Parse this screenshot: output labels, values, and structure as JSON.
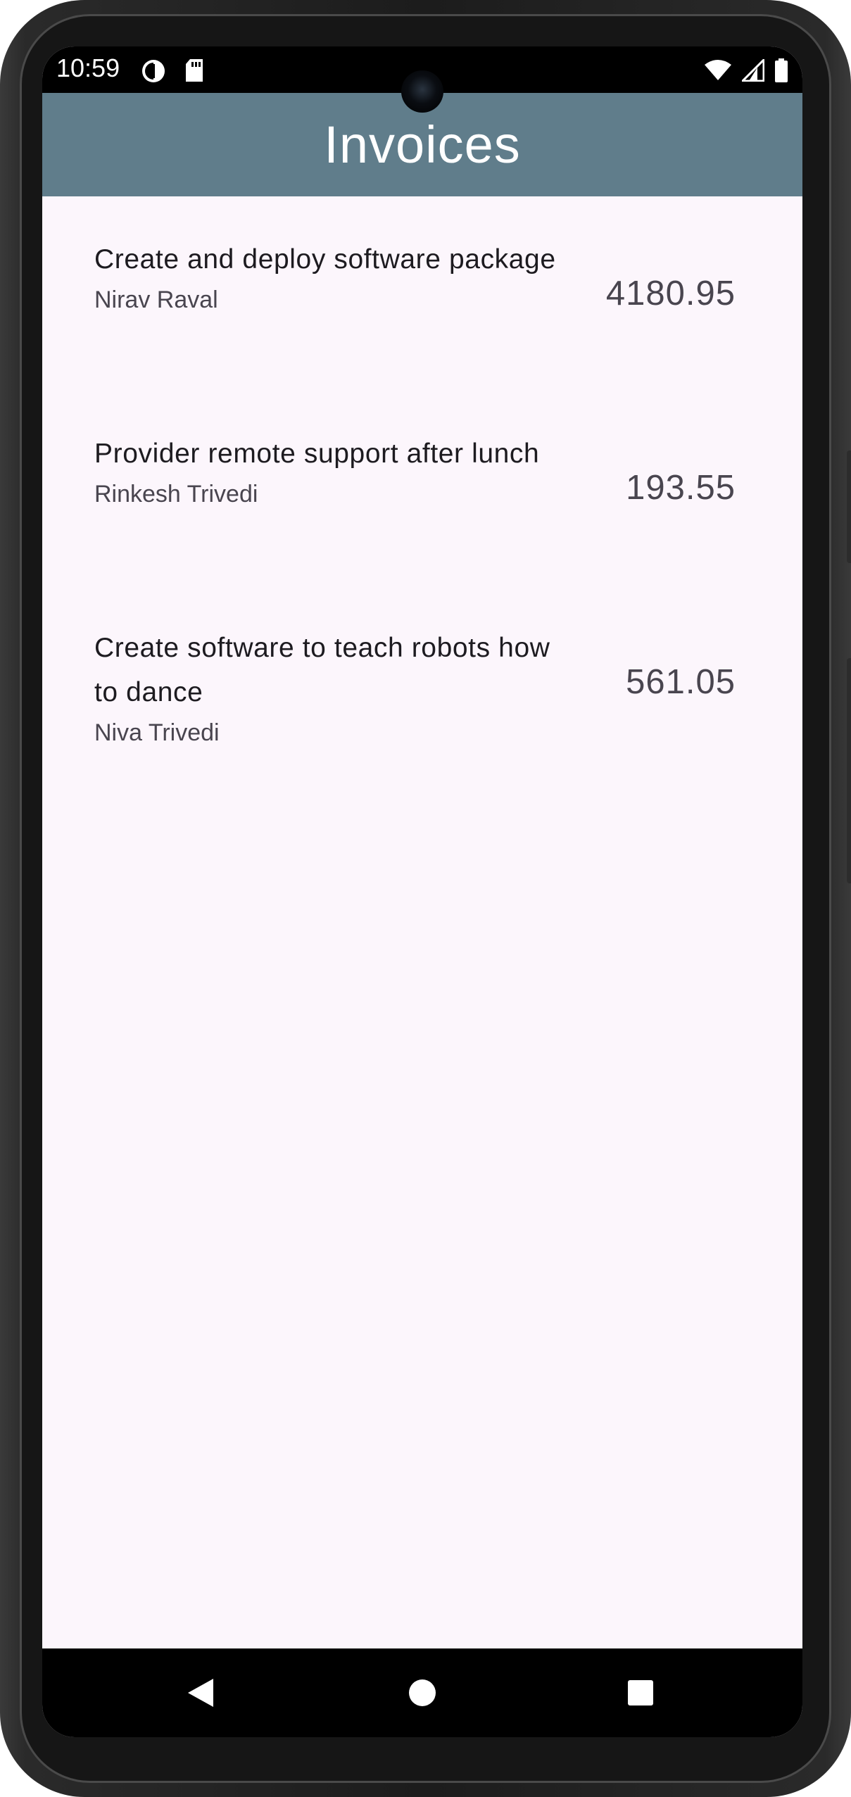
{
  "status_bar": {
    "time": "10:59",
    "left_icons": [
      "data-saver-icon",
      "sd-card-icon"
    ],
    "right_icons": [
      "wifi-icon",
      "signal-icon",
      "battery-icon"
    ]
  },
  "app_bar": {
    "title": "Invoices",
    "color": "#607d8b"
  },
  "invoices": [
    {
      "title": "Create and deploy software package",
      "subtitle": "Nirav Raval",
      "amount": "4180.95"
    },
    {
      "title": "Provider remote support after lunch",
      "subtitle": "Rinkesh Trivedi",
      "amount": "193.55"
    },
    {
      "title": "Create software to teach robots how to dance",
      "subtitle": "Niva Trivedi",
      "amount": "561.05"
    }
  ],
  "nav_bar": {
    "buttons": [
      "back-icon",
      "home-icon",
      "recents-icon"
    ]
  }
}
